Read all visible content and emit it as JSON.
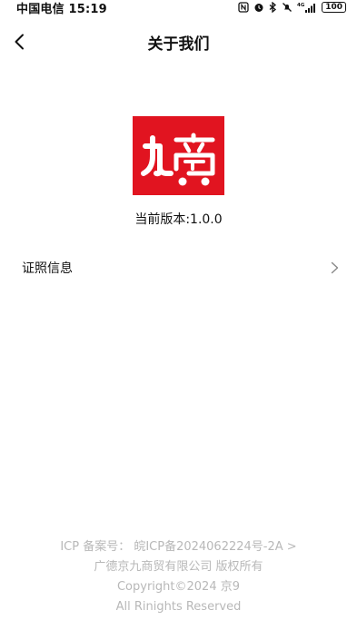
{
  "status_bar": {
    "carrier_time": "中国电信 15:19",
    "network": "4G",
    "battery": "100",
    "icons": [
      "nfc-icon",
      "alarm-icon",
      "bluetooth-icon",
      "mute-icon",
      "signal-icon",
      "battery-icon"
    ]
  },
  "header": {
    "title": "关于我们",
    "back_icon": "chevron-left-icon"
  },
  "logo": {
    "text": "九商",
    "brand_color": "#e11420"
  },
  "version": {
    "text": "当前版本:1.0.0"
  },
  "menu": {
    "license_label": "证照信息",
    "chevron_icon": "chevron-right-icon"
  },
  "footer": {
    "icp": "ICP 备案号：  皖ICP备2024062224号-2A >",
    "company": "广德京九商贸有限公司 版权所有",
    "copyright": "Copyright©2024 京9",
    "rights": "All Rinights Reserved"
  }
}
